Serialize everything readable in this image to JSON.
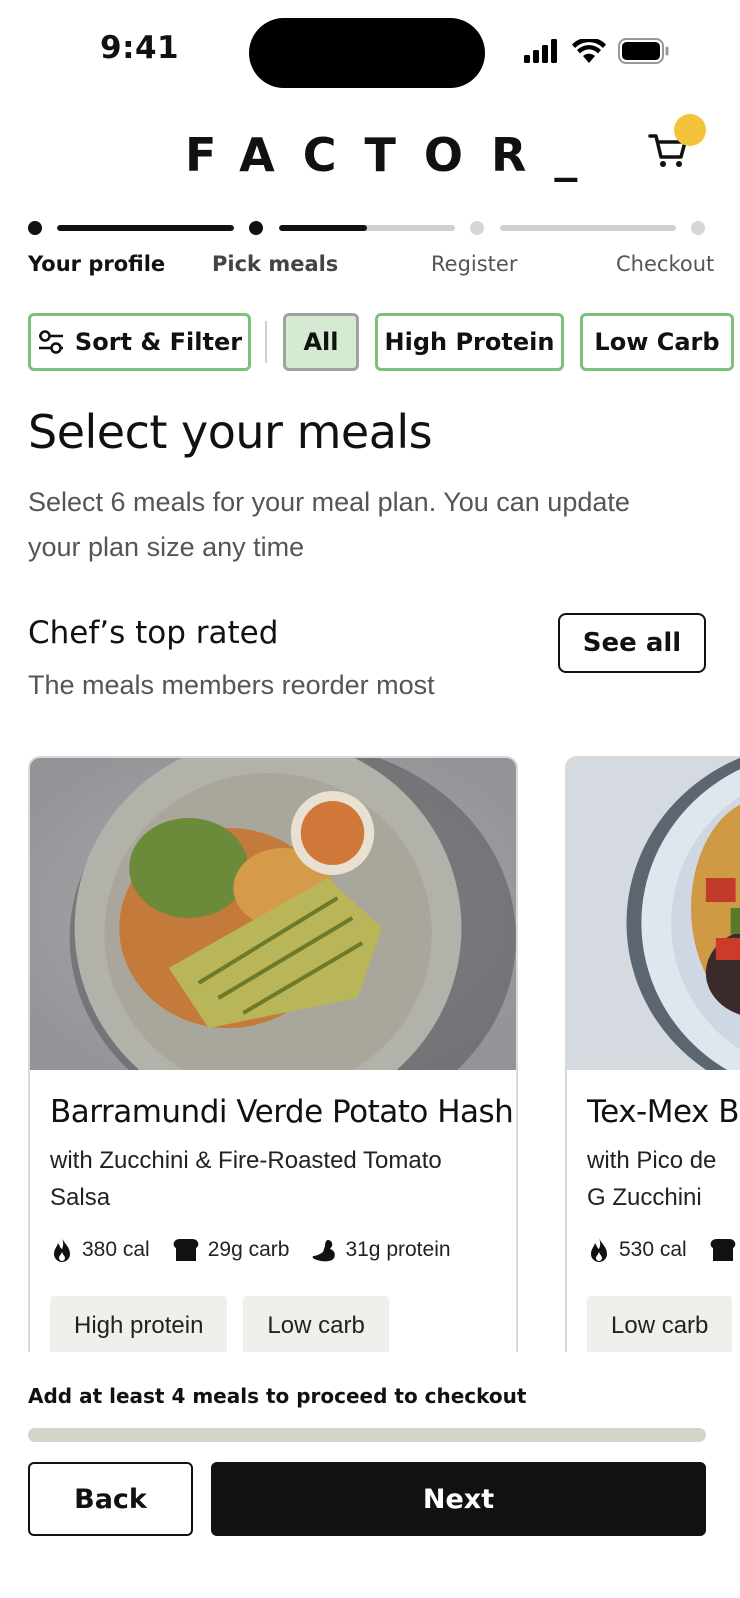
{
  "status_bar": {
    "time": "9:41"
  },
  "header": {
    "logo": "FACTOR_",
    "cart_badge_color": "#f5c33b"
  },
  "progress": {
    "steps": [
      {
        "label": "Your profile",
        "state": "complete"
      },
      {
        "label": "Pick meals",
        "state": "current",
        "fill_fraction": 0.5
      },
      {
        "label": "Register",
        "state": "upcoming"
      },
      {
        "label": "Checkout",
        "state": "upcoming"
      }
    ]
  },
  "filters": {
    "sort_filter_label": "Sort & Filter",
    "chips": [
      {
        "label": "All",
        "active": true
      },
      {
        "label": "High Protein",
        "active": false
      },
      {
        "label": "Low Carb",
        "active": false
      }
    ]
  },
  "main": {
    "title": "Select your meals",
    "subtitle": "Select 6 meals for your meal plan. You can update your plan size any time"
  },
  "section": {
    "title": "Chef’s top rated",
    "subtitle": "The meals members reorder most",
    "see_all_label": "See all"
  },
  "meals": [
    {
      "name": "Barramundi Verde Potato Hash",
      "description": "with Zucchini & Fire-Roasted Tomato Salsa",
      "calories": "380 cal",
      "carbs": "29g carb",
      "protein": "31g protein",
      "tags": [
        "High protein",
        "Low carb"
      ]
    },
    {
      "name": "Tex-Mex B",
      "description": "with Pico de G Zucchini",
      "calories": "530 cal",
      "tags": [
        "Low carb"
      ]
    }
  ],
  "footer": {
    "note": "Add at least 4 meals to proceed to checkout",
    "meals_selected_fraction": 0,
    "back_label": "Back",
    "next_label": "Next"
  },
  "colors": {
    "accent_green": "#7ac27a",
    "active_chip_bg": "#d4ebd2",
    "primary": "#111111"
  }
}
